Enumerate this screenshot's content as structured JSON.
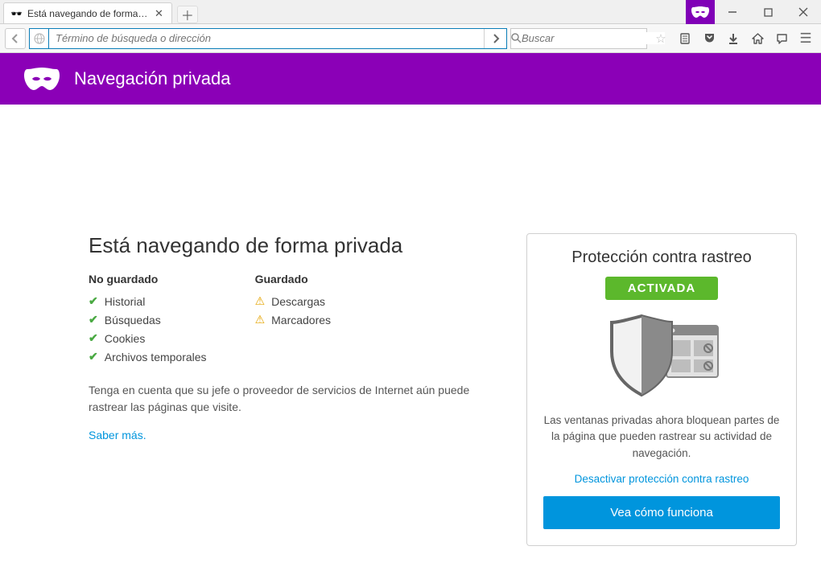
{
  "tab": {
    "title": "Está navegando de forma ..."
  },
  "urlbar": {
    "placeholder": "Término de búsqueda o dirección"
  },
  "searchbar": {
    "placeholder": "Buscar"
  },
  "banner": {
    "title": "Navegación privada"
  },
  "main": {
    "heading": "Está navegando de forma privada",
    "not_saved_label": "No guardado",
    "saved_label": "Guardado",
    "not_saved": [
      "Historial",
      "Búsquedas",
      "Cookies",
      "Archivos temporales"
    ],
    "saved": [
      "Descargas",
      "Marcadores"
    ],
    "note": "Tenga en cuenta que su jefe o proveedor de servicios de Internet aún puede rastrear las páginas que visite.",
    "learn_more": "Saber más."
  },
  "card": {
    "title": "Protección contra rastreo",
    "badge": "ACTIVADA",
    "desc": "Las ventanas privadas ahora bloquean partes de la página que pueden rastrear su actividad de navegación.",
    "disable": "Desactivar protección contra rastreo",
    "cta": "Vea cómo funciona"
  }
}
